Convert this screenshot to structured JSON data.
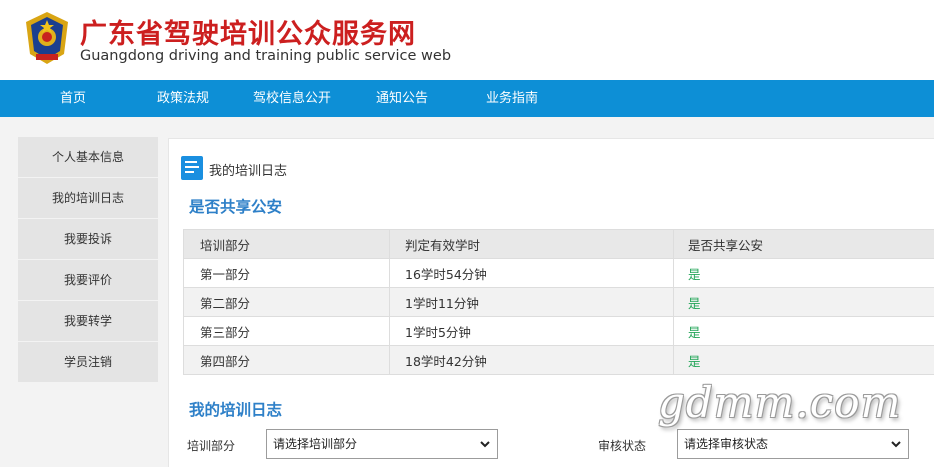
{
  "header": {
    "title": "广东省驾驶培训公众服务网",
    "subtitle": "Guangdong driving and training public service web",
    "emblem_icon": "police-emblem-icon"
  },
  "nav": {
    "items": [
      {
        "label": "首页"
      },
      {
        "label": "政策法规"
      },
      {
        "label": "驾校信息公开"
      },
      {
        "label": "通知公告"
      },
      {
        "label": "业务指南"
      }
    ]
  },
  "sidebar": {
    "items": [
      {
        "label": "个人基本信息"
      },
      {
        "label": "我的培训日志"
      },
      {
        "label": "我要投诉"
      },
      {
        "label": "我要评价"
      },
      {
        "label": "我要转学"
      },
      {
        "label": "学员注销"
      }
    ]
  },
  "panel": {
    "crumb": "我的培训日志",
    "crumb_icon": "document-icon",
    "share_section_title": "是否共享公安",
    "table": {
      "headers": [
        "培训部分",
        "判定有效学时",
        "是否共享公安"
      ],
      "rows": [
        {
          "part": "第一部分",
          "hours": "16学时54分钟",
          "shared": "是"
        },
        {
          "part": "第二部分",
          "hours": "1学时11分钟",
          "shared": "是"
        },
        {
          "part": "第三部分",
          "hours": "1学时5分钟",
          "shared": "是"
        },
        {
          "part": "第四部分",
          "hours": "18学时42分钟",
          "shared": "是"
        }
      ]
    },
    "log_section_title": "我的培训日志",
    "filters": {
      "part_label": "培训部分",
      "part_value": "请选择培训部分",
      "status_label": "审核状态",
      "status_value": "请选择审核状态"
    }
  },
  "watermark": "gdmm.com",
  "colors": {
    "brand_red": "#cc1f1f",
    "nav_blue": "#0d8fd6",
    "section_blue": "#2e80c8",
    "yes_green": "#23a558"
  }
}
